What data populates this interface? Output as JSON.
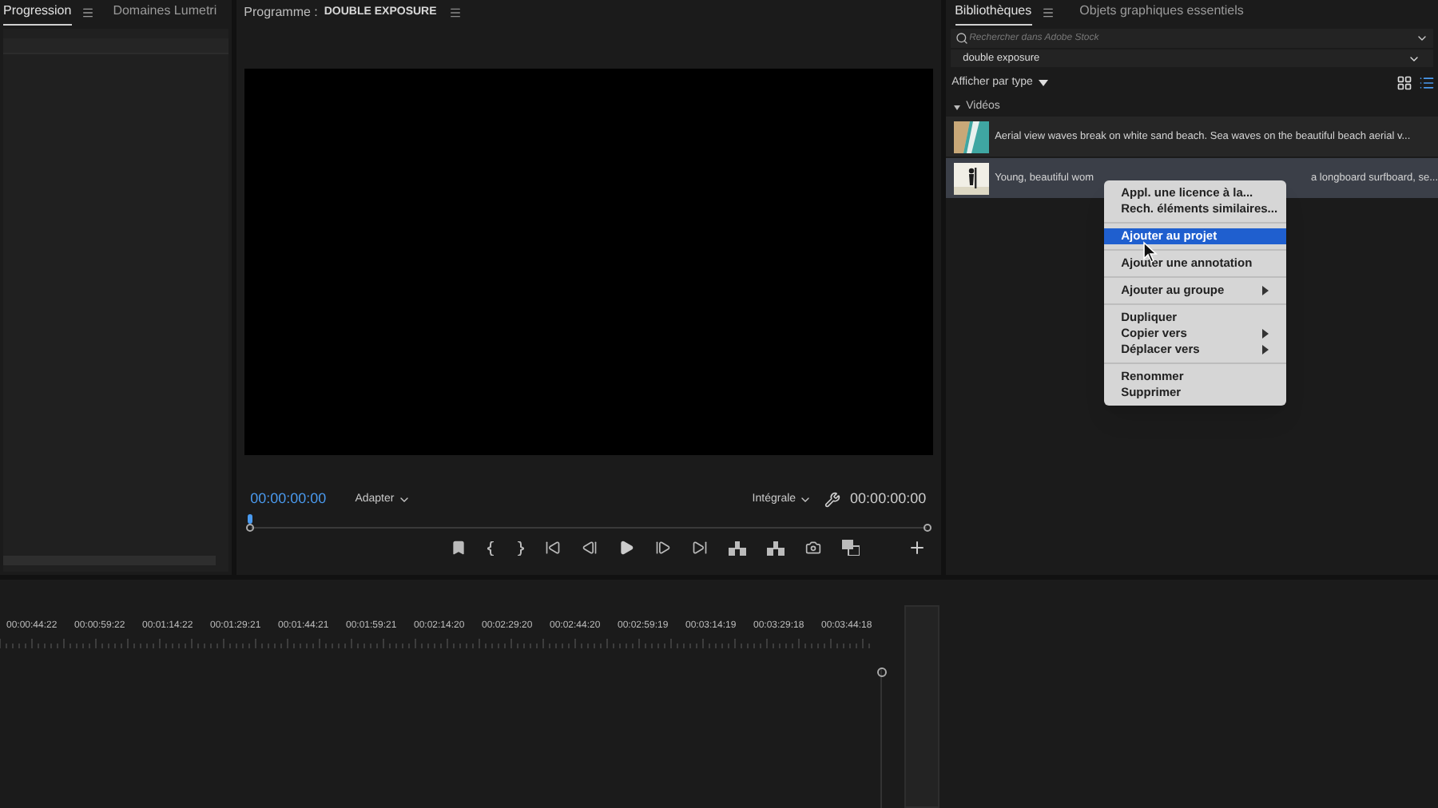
{
  "left_panel": {
    "tabs": [
      {
        "label": "Progression",
        "selected": true,
        "menu": true
      },
      {
        "label": "Domaines Lumetri",
        "selected": false,
        "menu": false
      }
    ]
  },
  "program_monitor": {
    "label": "Programme :",
    "sequence": "DOUBLE EXPOSURE",
    "playhead_time": "00:00:00:00",
    "zoom": "Adapter",
    "resolution": "Intégrale",
    "duration": "00:00:00:00",
    "level": 0
  },
  "libraries": {
    "tabs": [
      {
        "label": "Bibliothèques",
        "selected": true,
        "menu": true
      },
      {
        "label": "Objets graphiques essentiels",
        "selected": false,
        "menu": false
      }
    ],
    "search": {
      "placeholder": "Rechercher dans Adobe Stock"
    },
    "query": "double exposure",
    "view_by": "Afficher par type",
    "view_modes": [
      {
        "kind": "grid",
        "selected": false
      },
      {
        "kind": "list",
        "selected": true
      }
    ],
    "section": {
      "title": "Vidéos",
      "expanded": true
    },
    "items": [
      {
        "text": "Aerial view waves break on white sand beach. Sea waves on the beautiful beach aerial v...",
        "selected": false
      },
      {
        "text": "Young, beautiful wom",
        "text_after_menu": "a longboard surfboard, se...",
        "selected": true
      }
    ]
  },
  "context_menu": [
    {
      "kind": "item",
      "label": "Appl. une licence à la...",
      "selected": false,
      "submenu": false
    },
    {
      "kind": "item",
      "label": "Rech. éléments similaires...",
      "selected": false,
      "submenu": false
    },
    {
      "kind": "separator"
    },
    {
      "kind": "item",
      "label": "Ajouter au projet",
      "selected": true,
      "submenu": false
    },
    {
      "kind": "separator"
    },
    {
      "kind": "item",
      "label": "Ajouter une annotation",
      "selected": false,
      "submenu": false
    },
    {
      "kind": "separator"
    },
    {
      "kind": "item",
      "label": "Ajouter au groupe",
      "selected": false,
      "submenu": true
    },
    {
      "kind": "separator"
    },
    {
      "kind": "item",
      "label": "Dupliquer",
      "selected": false,
      "submenu": false
    },
    {
      "kind": "item",
      "label": "Copier vers",
      "selected": false,
      "submenu": true
    },
    {
      "kind": "item",
      "label": "Déplacer vers",
      "selected": false,
      "submenu": true
    },
    {
      "kind": "separator"
    },
    {
      "kind": "item",
      "label": "Renommer",
      "selected": false,
      "submenu": false
    },
    {
      "kind": "item",
      "label": "Supprimer",
      "selected": false,
      "submenu": false
    }
  ],
  "timeline": {
    "ruler_labels": [
      "00:00:44:22",
      "00:00:59:22",
      "00:01:14:22",
      "00:01:29:21",
      "00:01:44:21",
      "00:01:59:21",
      "00:02:14:20",
      "00:02:29:20",
      "00:02:44:20",
      "00:02:59:19",
      "00:03:14:19",
      "00:03:29:18",
      "00:03:44:18"
    ]
  }
}
